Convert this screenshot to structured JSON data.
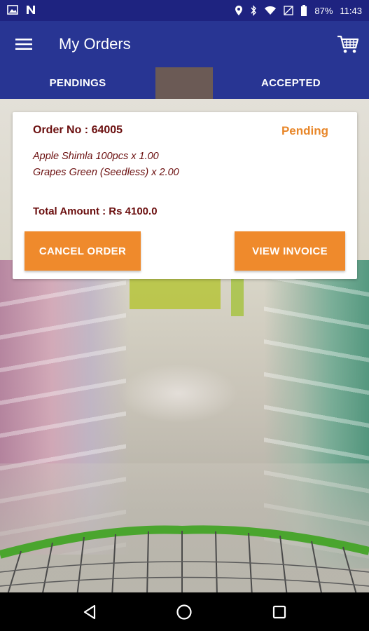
{
  "status_bar": {
    "battery": "87%",
    "time": "11:43",
    "icons": [
      "image-icon",
      "notification-n-icon",
      "location-icon",
      "bluetooth-icon",
      "wifi-icon",
      "no-sim-icon",
      "battery-icon"
    ]
  },
  "app_bar": {
    "title": "My Orders",
    "menu_icon": "hamburger-menu-icon",
    "cart_icon": "cart-icon"
  },
  "tabs": [
    {
      "label": "PENDINGS",
      "selected": true
    },
    {
      "label": "ACCEPTED",
      "selected": false
    }
  ],
  "order": {
    "order_no": "Order No : 64005",
    "status": "Pending",
    "items": "Apple Shimla 100pcs x 1.00 Grapes Green (Seedless) x 2.00",
    "total": "Total Amount : Rs 4100.0",
    "cancel_label": "CANCEL ORDER",
    "invoice_label": "VIEW INVOICE"
  },
  "colors": {
    "primary": "#283593",
    "status_bar": "#1e2380",
    "accent": "#ef8a2c",
    "text_dark_red": "#6b0f0f",
    "pending": "#e8872a"
  },
  "nav_bar": {
    "icons": [
      "back-icon",
      "home-icon",
      "recents-icon"
    ]
  }
}
